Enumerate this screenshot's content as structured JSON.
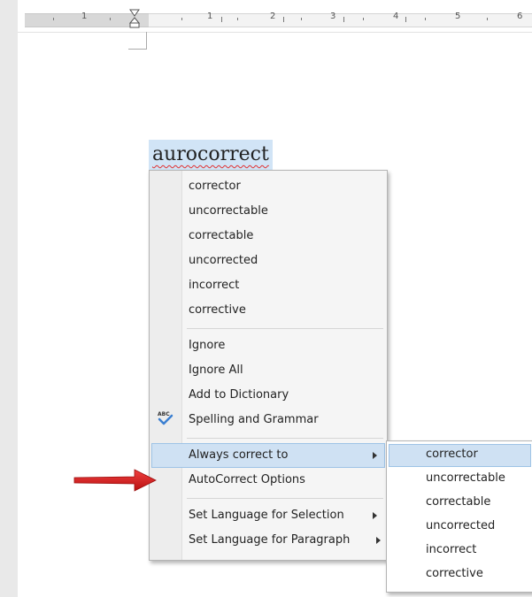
{
  "ruler": {
    "numbers": [
      "1",
      "1",
      "2",
      "3",
      "4",
      "5",
      "6"
    ]
  },
  "document": {
    "misspelled_word": "aurocorrect"
  },
  "context_menu": {
    "suggestions": [
      "corrector",
      "uncorrectable",
      "correctable",
      "uncorrected",
      "incorrect",
      "corrective"
    ],
    "ignore_label": "Ignore",
    "ignore_all_label": "Ignore All",
    "add_to_dictionary_label": "Add to Dictionary",
    "spelling_grammar_label": "Spelling and Grammar",
    "always_correct_label": "Always correct to",
    "autocorrect_options_label": "AutoCorrect Options",
    "set_language_selection_label": "Set Language for Selection",
    "set_language_paragraph_label": "Set Language for Paragraph"
  },
  "submenu": {
    "items": [
      "corrector",
      "uncorrectable",
      "correctable",
      "uncorrected",
      "incorrect",
      "corrective"
    ]
  },
  "colors": {
    "selection": "#d1e4f6",
    "highlight": "#cfe1f3",
    "arrow": "#e02020"
  }
}
